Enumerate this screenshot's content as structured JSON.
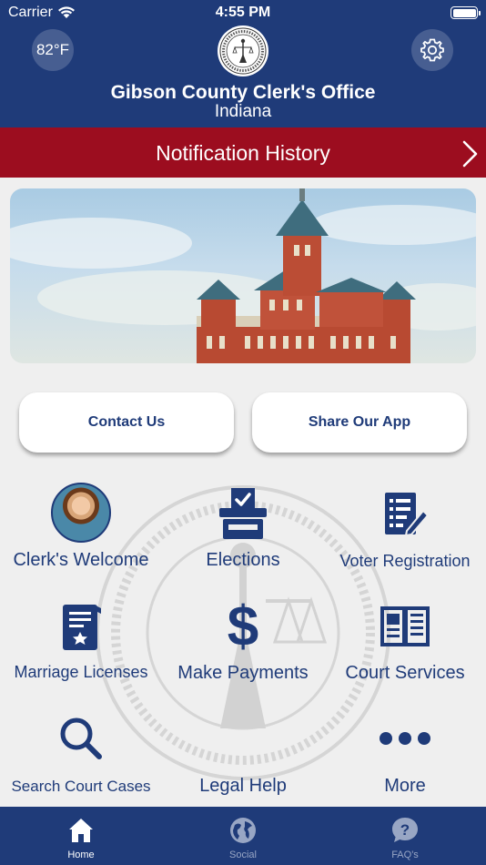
{
  "status_bar": {
    "carrier": "Carrier",
    "time": "4:55 PM"
  },
  "header": {
    "temperature": "82°F",
    "title": "Gibson County Clerk's Office",
    "subtitle": "Indiana"
  },
  "notification_bar": {
    "label": "Notification History"
  },
  "buttons": {
    "contact": "Contact Us",
    "share": "Share Our App"
  },
  "tiles": [
    {
      "label": "Clerk's Welcome",
      "icon": "clerk-avatar"
    },
    {
      "label": "Elections",
      "icon": "ballot-box-icon"
    },
    {
      "label": "Voter Registration",
      "icon": "clipboard-form-icon"
    },
    {
      "label": "Marriage Licenses",
      "icon": "certificate-icon"
    },
    {
      "label": "Make Payments",
      "icon": "dollar-icon"
    },
    {
      "label": "Court Services",
      "icon": "open-book-icon"
    },
    {
      "label": "Search Court Cases",
      "icon": "search-icon"
    },
    {
      "label": "Legal Help",
      "icon": ""
    },
    {
      "label": "More",
      "icon": "more-dots-icon"
    }
  ],
  "tab_bar": {
    "tabs": [
      {
        "label": "Home",
        "icon": "home-icon",
        "active": true
      },
      {
        "label": "Social",
        "icon": "globe-icon",
        "active": false
      },
      {
        "label": "FAQ's",
        "icon": "question-bubble-icon",
        "active": false
      }
    ]
  },
  "colors": {
    "primary": "#1f3b79",
    "accent": "#9c0d1f",
    "background": "#efefef"
  }
}
